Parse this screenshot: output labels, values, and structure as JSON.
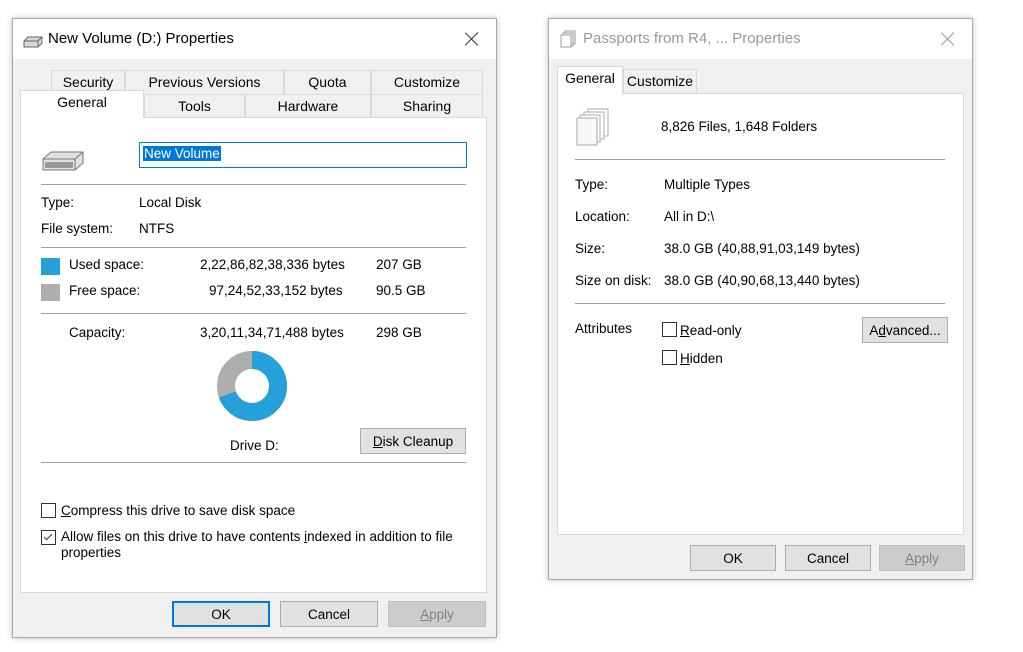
{
  "left": {
    "title": "New Volume (D:) Properties",
    "tabs_row1": [
      "Security",
      "Previous Versions",
      "Quota",
      "Customize"
    ],
    "tabs_row2": [
      "General",
      "Tools",
      "Hardware",
      "Sharing"
    ],
    "active_tab": "General",
    "name_value": "New Volume",
    "type_label": "Type:",
    "type_value": "Local Disk",
    "fs_label": "File system:",
    "fs_value": "NTFS",
    "used_label": "Used space:",
    "used_bytes": "2,22,86,82,38,336 bytes",
    "used_gb": "207 GB",
    "free_label": "Free space:",
    "free_bytes": "97,24,52,33,152 bytes",
    "free_gb": "90.5 GB",
    "cap_label": "Capacity:",
    "cap_bytes": "3,20,11,34,71,488 bytes",
    "cap_gb": "298 GB",
    "used_fraction": 0.696,
    "used_color": "#26a0da",
    "free_color": "#aeaeae",
    "drive_label": "Drive D:",
    "disk_cleanup_rest": "isk Cleanup",
    "disk_cleanup_mnemonic": "D",
    "compress_mnemonic": "C",
    "compress_rest": "ompress this drive to save disk space",
    "compress_checked": false,
    "index_text_a": "Allow files on this drive to have contents ",
    "index_mnemonic": "i",
    "index_text_b": "ndexed in addition to file properties",
    "index_checked": true,
    "ok": "OK",
    "cancel": "Cancel",
    "apply_mnemonic": "A",
    "apply_rest": "pply"
  },
  "right": {
    "title": "Passports from R4, ... Properties",
    "tabs": [
      "General",
      "Customize"
    ],
    "active_tab": "General",
    "summary": "8,826 Files, 1,648 Folders",
    "type_label": "Type:",
    "type_value": "Multiple Types",
    "location_label": "Location:",
    "location_value": "All in D:\\",
    "size_label": "Size:",
    "size_value": "38.0 GB (40,88,91,03,149 bytes)",
    "size_disk_label": "Size on disk:",
    "size_disk_value": "38.0 GB (40,90,68,13,440 bytes)",
    "attributes_label": "Attributes",
    "readonly_mnemonic": "R",
    "readonly_rest": "ead-only",
    "readonly_checked": false,
    "hidden_mnemonic": "H",
    "hidden_rest": "idden",
    "hidden_checked": false,
    "advanced_mnemonic": "d",
    "advanced_a": "A",
    "advanced_b": "vanced...",
    "ok": "OK",
    "cancel": "Cancel",
    "apply_mnemonic": "A",
    "apply_rest": "pply"
  }
}
